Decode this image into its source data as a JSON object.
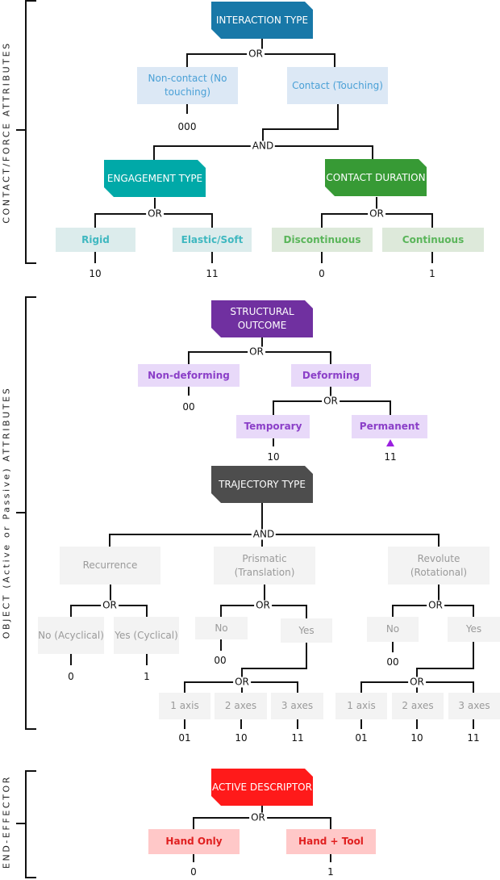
{
  "colors": {
    "interaction": "#1878a8",
    "engagement": "#00a9a8",
    "duration": "#379a35",
    "structural": "#7030a0",
    "trajectory": "#4d4d4d",
    "active": "#ff1a1a",
    "marker": "#9b20e0"
  },
  "sections": {
    "contact": {
      "label": "CONTACT/FORCE ATTRIBUTES"
    },
    "object": {
      "label": "OBJECT (Active or Passive) ATTRIBUTES"
    },
    "end_effector": {
      "label": "END-EFFECTOR"
    }
  },
  "interaction": {
    "title": "INTERACTION TYPE",
    "op": "OR",
    "non_contact": "Non-contact (No touching)",
    "contact": "Contact (Touching)",
    "non_contact_code": "000",
    "and_op": "AND"
  },
  "engagement": {
    "title": "ENGAGEMENT TYPE",
    "op": "OR",
    "options": [
      "Rigid",
      "Elastic/Soft"
    ],
    "codes": [
      "10",
      "11"
    ]
  },
  "duration": {
    "title": "CONTACT DURATION",
    "op": "OR",
    "options": [
      "Discontinuous",
      "Continuous"
    ],
    "codes": [
      "0",
      "1"
    ]
  },
  "structural": {
    "title": "STRUCTURAL OUTCOME",
    "op": "OR",
    "non_deforming": "Non-deforming",
    "deforming": "Deforming",
    "non_deforming_code": "00",
    "sub_op": "OR",
    "sub_options": [
      "Temporary",
      "Permanent"
    ],
    "sub_codes": [
      "10",
      "11"
    ]
  },
  "trajectory": {
    "title": "TRAJECTORY TYPE",
    "op": "AND",
    "recurrence": {
      "label": "Recurrence",
      "op": "OR",
      "options": [
        "No (Acyclical)",
        "Yes (Cyclical)"
      ],
      "codes": [
        "0",
        "1"
      ]
    },
    "prismatic": {
      "label": "Prismatic (Translation)",
      "op": "OR",
      "no": "No",
      "yes": "Yes",
      "no_code": "00",
      "axes_op": "OR",
      "axes": [
        "1 axis",
        "2 axes",
        "3 axes"
      ],
      "codes": [
        "01",
        "10",
        "11"
      ]
    },
    "revolute": {
      "label": "Revolute (Rotational)",
      "op": "OR",
      "no": "No",
      "yes": "Yes",
      "no_code": "00",
      "axes_op": "OR",
      "axes": [
        "1 axis",
        "2 axes",
        "3 axes"
      ],
      "codes": [
        "01",
        "10",
        "11"
      ]
    }
  },
  "active": {
    "title": "ACTIVE DESCRIPTOR",
    "op": "OR",
    "options": [
      "Hand Only",
      "Hand + Tool"
    ],
    "codes": [
      "0",
      "1"
    ]
  }
}
